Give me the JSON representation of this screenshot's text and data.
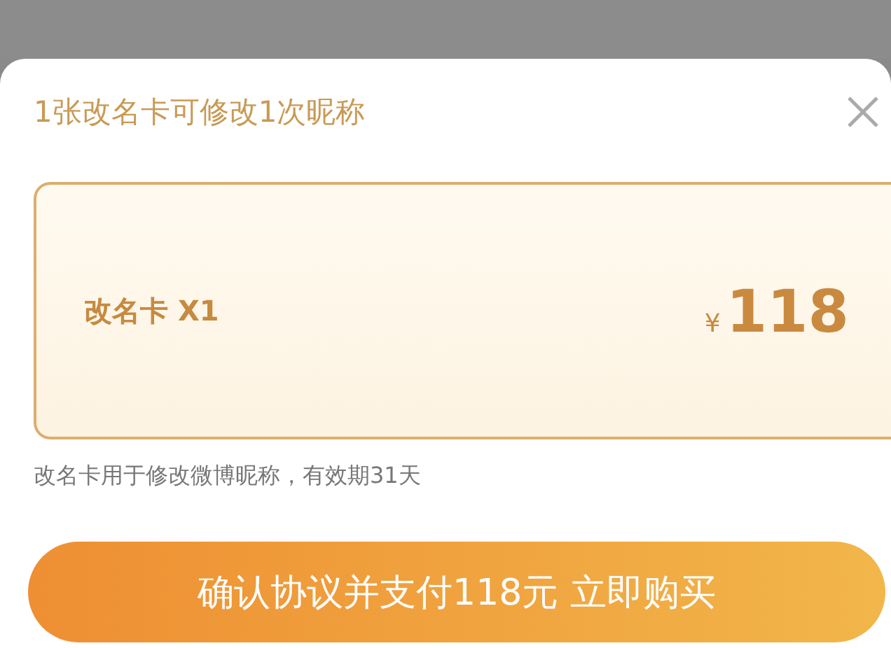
{
  "sheet": {
    "title": "1张改名卡可修改1次昵称"
  },
  "card": {
    "name": "改名卡 X1",
    "currency": "¥",
    "price": "118"
  },
  "note": "改名卡用于修改微博昵称，有效期31天",
  "button": {
    "label": "确认协议并支付118元 立即购买"
  }
}
